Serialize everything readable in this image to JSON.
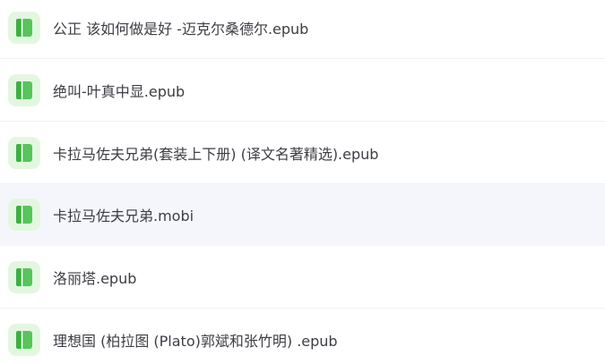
{
  "file_list": {
    "items": [
      {
        "name": "公正 该如何做是好 -迈克尔桑德尔.epub",
        "icon": "ebook-file-icon"
      },
      {
        "name": "绝叫-叶真中显.epub",
        "icon": "ebook-file-icon"
      },
      {
        "name": "卡拉马佐夫兄弟(套装上下册) (译文名著精选).epub",
        "icon": "ebook-file-icon"
      },
      {
        "name": "卡拉马佐夫兄弟.mobi",
        "icon": "ebook-file-icon"
      },
      {
        "name": "洛丽塔.epub",
        "icon": "ebook-file-icon"
      },
      {
        "name": "理想国 (柏拉图 (Plato)郭斌和张竹明) .epub",
        "icon": "ebook-file-icon"
      }
    ],
    "hovered_index": 3
  },
  "colors": {
    "icon_background": "#e3f7e0",
    "icon_green": "#58c45b",
    "icon_green_dark": "#3fae44",
    "hover_background": "#f5f6fc",
    "text": "#3d3d44"
  }
}
